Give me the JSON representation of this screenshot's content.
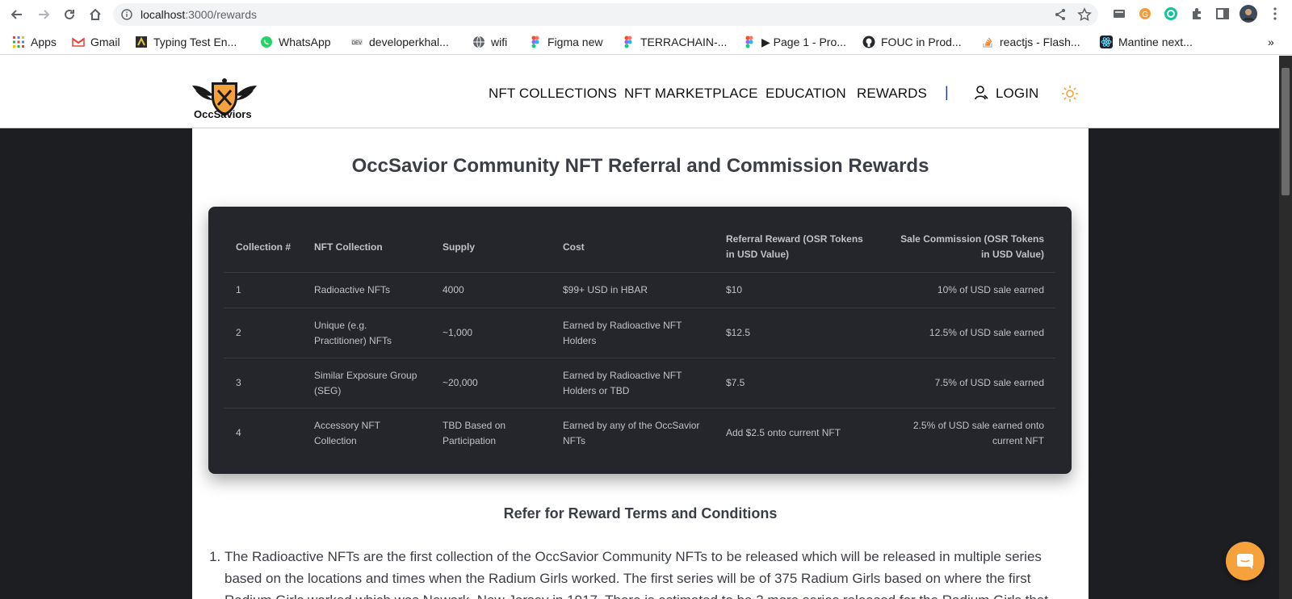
{
  "browser": {
    "url_host": "localhost",
    "url_path": ":3000/rewards",
    "bookmarks": [
      {
        "label": "Apps"
      },
      {
        "label": "Gmail"
      },
      {
        "label": "Typing Test En..."
      },
      {
        "label": "WhatsApp"
      },
      {
        "label": "developerkhal..."
      },
      {
        "label": "wifi"
      },
      {
        "label": "Figma new"
      },
      {
        "label": "TERRACHAIN-..."
      },
      {
        "label": "▶ Page 1 - Pro..."
      },
      {
        "label": "FOUC in Prod..."
      },
      {
        "label": "reactjs - Flash..."
      },
      {
        "label": "Mantine next..."
      }
    ],
    "more": "»"
  },
  "header": {
    "logo_text": "OccSaviors",
    "nav": [
      {
        "label": "NFT COLLECTIONS"
      },
      {
        "label": "NFT MARKETPLACE"
      },
      {
        "label": "EDUCATION"
      },
      {
        "label": "REWARDS"
      }
    ],
    "separator": "|",
    "login": "LOGIN"
  },
  "main": {
    "title": "OccSavior Community NFT Referral and Commission Rewards",
    "table": {
      "headers": [
        "Collection #",
        "NFT Collection",
        "Supply",
        "Cost",
        "Referral Reward (OSR Tokens in USD Value)",
        "Sale Commission (OSR Tokens in USD Value)"
      ],
      "rows": [
        [
          "1",
          "Radioactive NFTs",
          "4000",
          "$99+ USD in HBAR",
          "$10",
          "10% of USD sale earned"
        ],
        [
          "2",
          "Unique (e.g. Practitioner) NFTs",
          "~1,000",
          "Earned by Radioactive NFT Holders",
          "$12.5",
          "12.5% of USD sale earned"
        ],
        [
          "3",
          "Similar Exposure Group (SEG)",
          "~20,000",
          "Earned by Radioactive NFT Holders or TBD",
          "$7.5",
          "7.5% of USD sale earned"
        ],
        [
          "4",
          "Accessory NFT Collection",
          "TBD Based on Participation",
          "Earned by any of the OccSavior NFTs",
          "Add $2.5 onto current NFT",
          "2.5% of USD sale earned onto current NFT"
        ]
      ]
    },
    "terms_title": "Refer for Reward Terms and Conditions",
    "terms": [
      "The Radioactive NFTs are the first collection of the OccSavior Community NFTs to be released which will be released in multiple series based on the locations and times when the Radium Girls worked. The first series will be of 375 Radium Girls based on where the first Radium Girls worked which was Newark, New Jersey in 1917. There is estimated to be 3 more series released for the Radium Girls that"
    ]
  },
  "colors": {
    "page_bg": "#1d1e22",
    "table_bg": "#25262b",
    "fab": "#f5a23c",
    "logo_shield": "#f5a23c"
  }
}
